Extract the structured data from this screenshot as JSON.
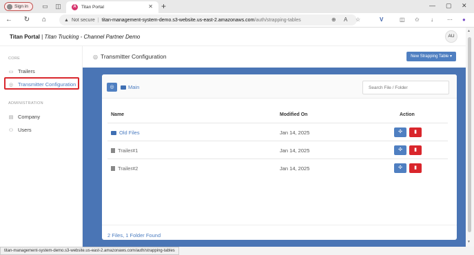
{
  "browser": {
    "signin_label": "Sign in",
    "tab_title": "Titan Portal",
    "not_secure": "Not secure",
    "url_host": "titan-management-system-demo.s3-website.us-east-2.amazonaws.com",
    "url_path": "/auth/strapping-tables",
    "status_url": "titan-management-system-demo.s3-website.us-east-2.amazonaws.com/auth/strapping-tables"
  },
  "header": {
    "brand": "Titan Portal",
    "brand_sep": " | ",
    "subtitle": "Titan Trucking - Channel Partner Demo",
    "avatar": "AU"
  },
  "sidebar": {
    "core_heading": "CORE",
    "admin_heading": "ADMINISTRATION",
    "items": [
      {
        "label": "Trailers",
        "icon": "truck-icon"
      },
      {
        "label": "Transmitter Configuration",
        "icon": "gear-icon"
      },
      {
        "label": "Company",
        "icon": "building-icon"
      },
      {
        "label": "Users",
        "icon": "users-icon"
      }
    ]
  },
  "main": {
    "title": "Transmitter Configuration",
    "new_button": "New Strapping Table ▾",
    "breadcrumb": "Main",
    "search_placeholder": "Search File / Folder",
    "columns": {
      "name": "Name",
      "modified": "Modified On",
      "action": "Action"
    },
    "rows": [
      {
        "name": "Old Files",
        "type": "folder",
        "modified": "Jan 14, 2025"
      },
      {
        "name": "Trailer#1",
        "type": "file",
        "modified": "Jan 14, 2025"
      },
      {
        "name": "Trailer#2",
        "type": "file",
        "modified": "Jan 14, 2025"
      }
    ],
    "summary": "2 Files, 1 Folder Found"
  },
  "colors": {
    "accent": "#4f7fc1",
    "panel": "#4a75b5",
    "danger": "#d9262c",
    "folder": "#3f6fb3"
  }
}
